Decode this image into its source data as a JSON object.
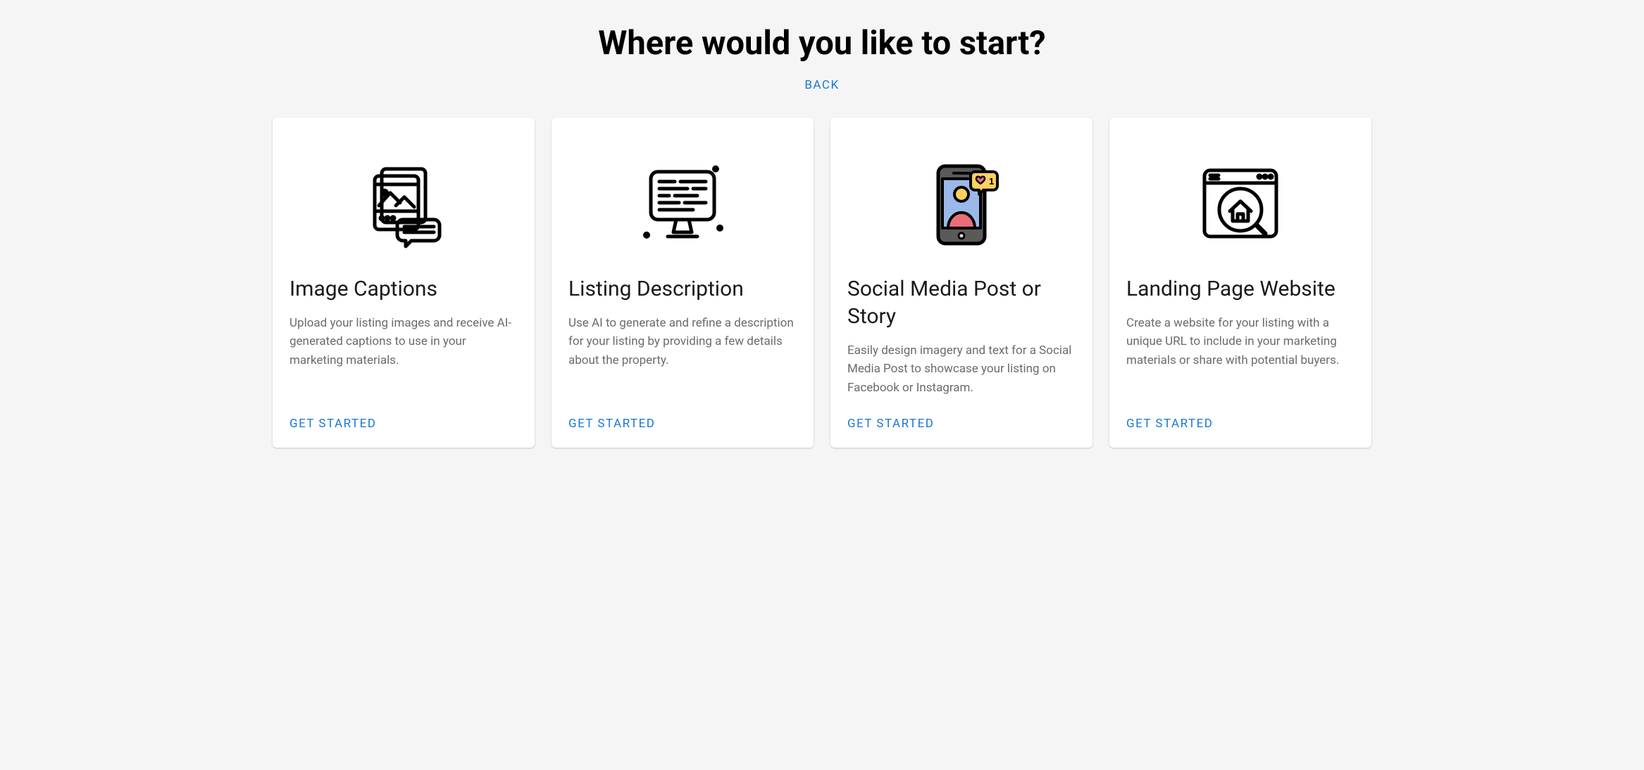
{
  "header": {
    "title": "Where would you like to start?",
    "back_label": "BACK"
  },
  "cards": [
    {
      "icon": "image-captions-icon",
      "title": "Image Captions",
      "description": "Upload your listing images and receive AI-generated captions to use in your marketing materials.",
      "cta": "GET STARTED"
    },
    {
      "icon": "listing-description-icon",
      "title": "Listing Description",
      "description": "Use AI to generate and refine a description for your listing by providing a few details about the property.",
      "cta": "GET STARTED"
    },
    {
      "icon": "social-media-icon",
      "title": "Social Media Post or Story",
      "description": "Easily design imagery and text for a Social Media Post to showcase your listing on Facebook or Instagram.",
      "cta": "GET STARTED"
    },
    {
      "icon": "landing-page-icon",
      "title": "Landing Page Website",
      "description": "Create a website for your listing with a unique URL to include in your marketing materials or share with potential buyers.",
      "cta": "GET STARTED"
    }
  ]
}
